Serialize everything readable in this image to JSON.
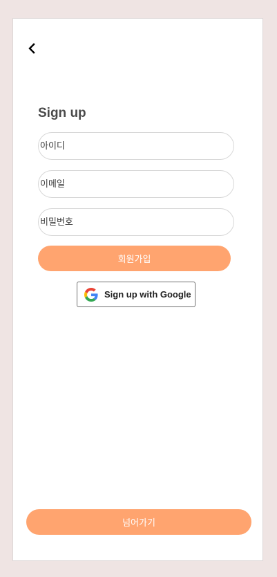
{
  "header": {
    "back_icon": "chevron-left-icon"
  },
  "form": {
    "title": "Sign up",
    "id_placeholder": "아이디",
    "email_placeholder": "이메일",
    "password_placeholder": "비밀번호",
    "submit_label": "회원가입"
  },
  "google": {
    "label": "Sign up with Google",
    "icon": "google-g-icon"
  },
  "footer": {
    "skip_label": "넘어가기"
  },
  "colors": {
    "accent": "#ffa46f",
    "background": "#efe4e3",
    "card": "#ffffff"
  }
}
